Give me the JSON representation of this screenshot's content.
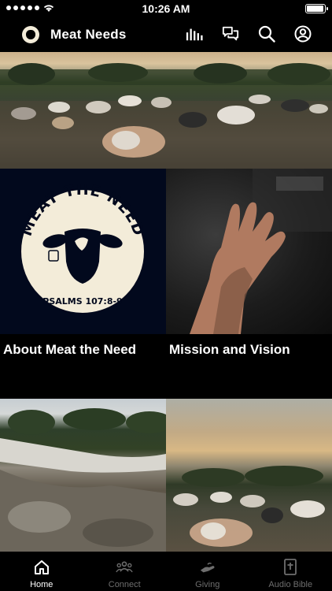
{
  "status_bar": {
    "time": "10:26 AM",
    "battery_level": 0.95
  },
  "header": {
    "title": "Meat Needs",
    "icons": [
      "stats-icon",
      "chat-icon",
      "search-icon",
      "profile-icon"
    ]
  },
  "hero": {
    "image": "cattle-herd-sunset"
  },
  "tiles": [
    {
      "label": "About Meat the Need",
      "logo_arc_text": "MEAT THE NEED",
      "logo_verse": "PSALMS 107:8-9"
    },
    {
      "label": "Mission and Vision"
    },
    {
      "image": "mud-ground"
    },
    {
      "image": "cattle-herd-dusk"
    }
  ],
  "tab_bar": {
    "tabs": [
      {
        "label": "Home",
        "icon": "home-icon",
        "active": true
      },
      {
        "label": "Connect",
        "icon": "people-icon",
        "active": false
      },
      {
        "label": "Giving",
        "icon": "giving-hand-icon",
        "active": false
      },
      {
        "label": "Audio Bible",
        "icon": "bible-icon",
        "active": false
      }
    ]
  },
  "colors": {
    "background": "#000000",
    "logo_navy": "#02091d",
    "logo_cream": "#f3ecd9",
    "tab_inactive": "#6e6e6e"
  }
}
